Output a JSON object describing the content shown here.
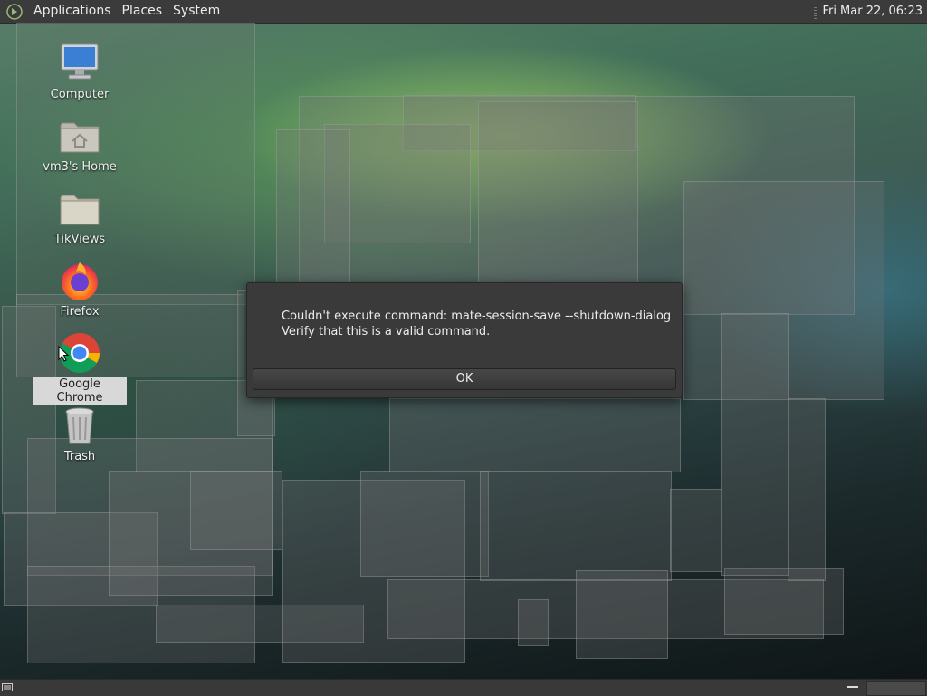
{
  "top_panel": {
    "menus": [
      "Applications",
      "Places",
      "System"
    ],
    "clock": "Fri Mar 22, 06:23"
  },
  "desktop": {
    "icons": [
      {
        "label": "Computer",
        "icon": "computer-icon"
      },
      {
        "label": "vm3's Home",
        "icon": "home-folder-icon"
      },
      {
        "label": "TikViews",
        "icon": "folder-icon"
      },
      {
        "label": "Firefox",
        "icon": "firefox-icon"
      },
      {
        "label": "Google Chrome",
        "icon": "chrome-icon"
      },
      {
        "label": "Trash",
        "icon": "trash-icon"
      }
    ]
  },
  "dialog": {
    "line1": "Couldn't execute command: mate-session-save --shutdown-dialog",
    "line2": "Verify that this is a valid command.",
    "ok_label": "OK"
  },
  "colors": {
    "panel": "#3b3b3b",
    "dialog_bg": "#3a3a3a",
    "selected_label_bg": "#d8d8d8"
  }
}
